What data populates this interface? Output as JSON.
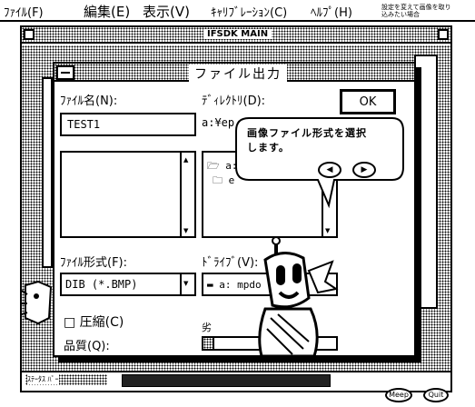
{
  "menubar": {
    "items": [
      {
        "label": "ﾌｧｲﾙ(F)"
      },
      {
        "label": "編集(E)"
      },
      {
        "label": "表示(V)"
      },
      {
        "label": "ｷｬﾘﾌﾞﾚｰｼｮﾝ(C)"
      },
      {
        "label": "ﾍﾙﾌﾟ(H)"
      }
    ],
    "hint_line1": "設定を変えて画像を取り",
    "hint_line2": "込みたい場合"
  },
  "bg_window": {
    "title": "IFSDK MAIN"
  },
  "dialog": {
    "title": "ファイル出力",
    "filename_label": "ﾌｧｲﾙ名(N):",
    "filename_value": "TEST1",
    "directory_label": "ﾃﾞｨﾚｸﾄﾘ(D):",
    "directory_value": "a:¥ep",
    "dir_list": [
      "a:",
      "e"
    ],
    "ok_label": "OK",
    "filetype_label": "ﾌｧｲﾙ形式(F):",
    "filetype_value": "DIB (*.BMP)",
    "drive_label": "ﾄﾞﾗｲﾌﾞ(V):",
    "drive_value": "a: mpdo",
    "compress_label": "□ 圧縮(C)",
    "quality_label": "品質(Q):",
    "quality_low": "劣"
  },
  "balloon": {
    "line1": "画像ファイル形式を選択",
    "line2": "します。"
  },
  "status": {
    "left_text": "ｽﾃｰﾀｽ ﾊﾞｰ",
    "btn1": "Meep",
    "btn2": "Quit"
  },
  "colors": {
    "ink": "#000000",
    "paper": "#ffffff"
  }
}
